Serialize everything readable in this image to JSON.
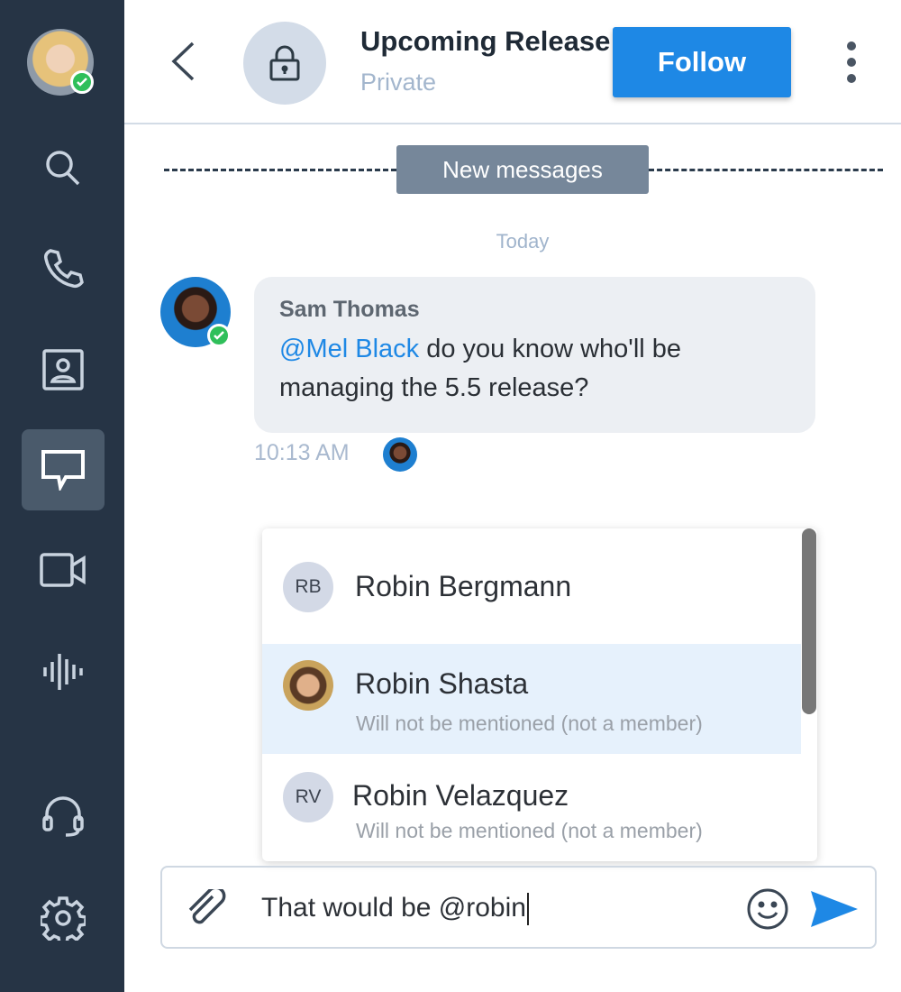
{
  "sidebar": {
    "items": [
      {
        "name": "search",
        "icon": "search-icon"
      },
      {
        "name": "calls",
        "icon": "phone-icon"
      },
      {
        "name": "contacts",
        "icon": "contact-card-icon"
      },
      {
        "name": "messages",
        "icon": "chat-bubble-icon",
        "active": true
      },
      {
        "name": "video",
        "icon": "video-camera-icon"
      },
      {
        "name": "voicemail",
        "icon": "voicemail-waveform-icon"
      },
      {
        "name": "support",
        "icon": "headset-icon"
      },
      {
        "name": "settings",
        "icon": "gear-icon"
      }
    ],
    "user_status": "online"
  },
  "header": {
    "title": "Upcoming Release",
    "subtitle": "Private",
    "follow_label": "Follow"
  },
  "chat": {
    "divider_label": "New messages",
    "date_label": "Today",
    "messages": [
      {
        "sender": "Sam Thomas",
        "mention": "@Mel Black",
        "text": " do you know who'll be managing the 5.5 release?",
        "time": "10:13 AM"
      }
    ]
  },
  "mention_suggestions": [
    {
      "initials": "RB",
      "name": "Robin Bergmann",
      "note": ""
    },
    {
      "initials": "",
      "name": "Robin Shasta",
      "note": "Will not be mentioned (not a member)",
      "highlighted": true
    },
    {
      "initials": "RV",
      "name": "Robin Velazquez",
      "note": "Will not be mentioned (not a member)"
    }
  ],
  "composer": {
    "value": "That would be @robin"
  },
  "colors": {
    "sidebar": "#263445",
    "accent": "#1e88e5",
    "online": "#2fbf5a",
    "highlight": "#e6f1fc"
  }
}
